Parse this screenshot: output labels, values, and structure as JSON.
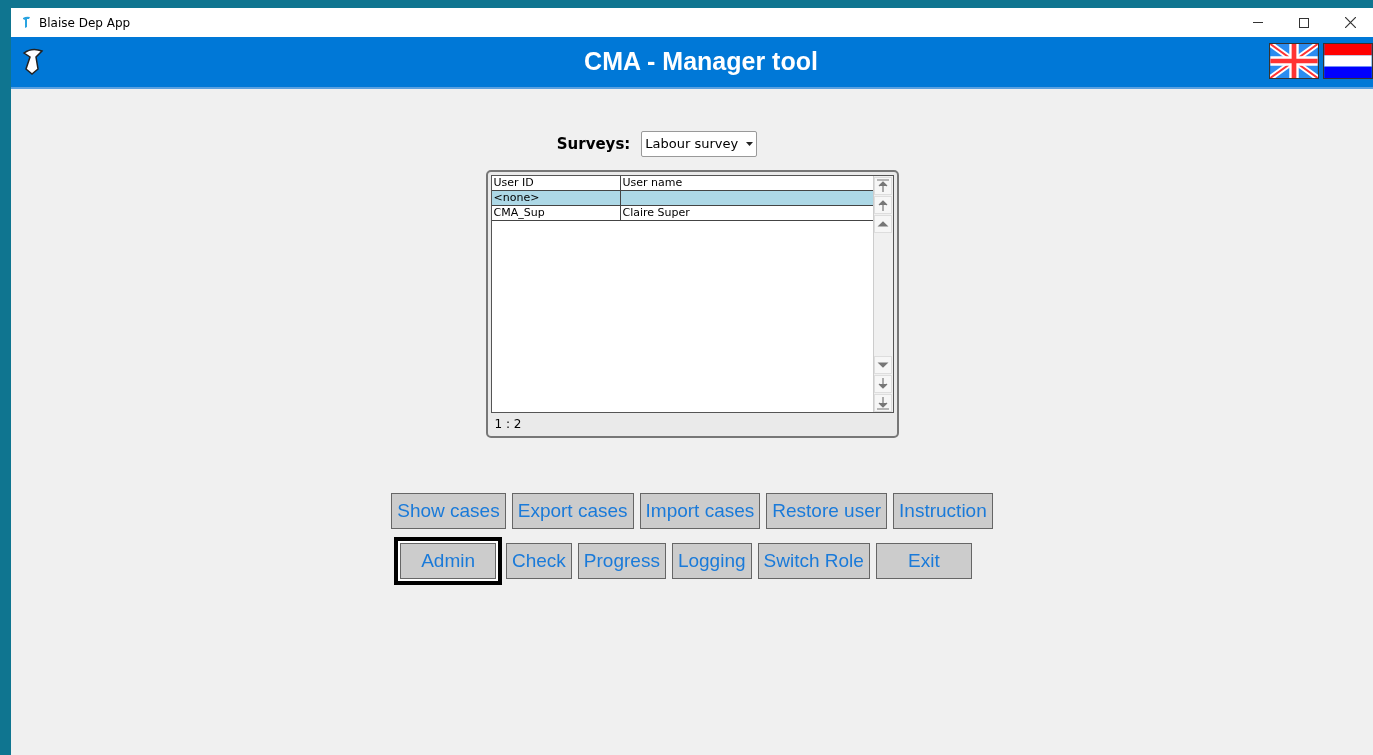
{
  "window": {
    "title": "Blaise Dep App"
  },
  "header": {
    "title": "CMA - Manager tool",
    "languages": [
      {
        "kind": "uk"
      },
      {
        "kind": "nl"
      }
    ]
  },
  "surveys": {
    "label": "Surveys:",
    "value": "Labour survey"
  },
  "table": {
    "columns": [
      "User ID",
      "User name"
    ],
    "rows": [
      {
        "cells": [
          "<none>",
          ""
        ],
        "selected": true
      },
      {
        "cells": [
          "CMA_Sup",
          "Claire Super"
        ],
        "selected": false
      }
    ],
    "footer": "1 : 2"
  },
  "button_rows": [
    [
      {
        "label": "Show cases",
        "focused": false
      },
      {
        "label": "Export cases",
        "focused": false
      },
      {
        "label": "Import cases",
        "focused": false
      },
      {
        "label": "Restore user",
        "focused": false
      },
      {
        "label": "Instruction",
        "focused": false
      }
    ],
    [
      {
        "label": "Admin",
        "focused": true
      },
      {
        "label": "Check",
        "focused": false
      },
      {
        "label": "Progress",
        "focused": false
      },
      {
        "label": "Logging",
        "focused": false
      },
      {
        "label": "Switch Role",
        "focused": false
      },
      {
        "label": "Exit",
        "focused": false
      }
    ]
  ]
}
